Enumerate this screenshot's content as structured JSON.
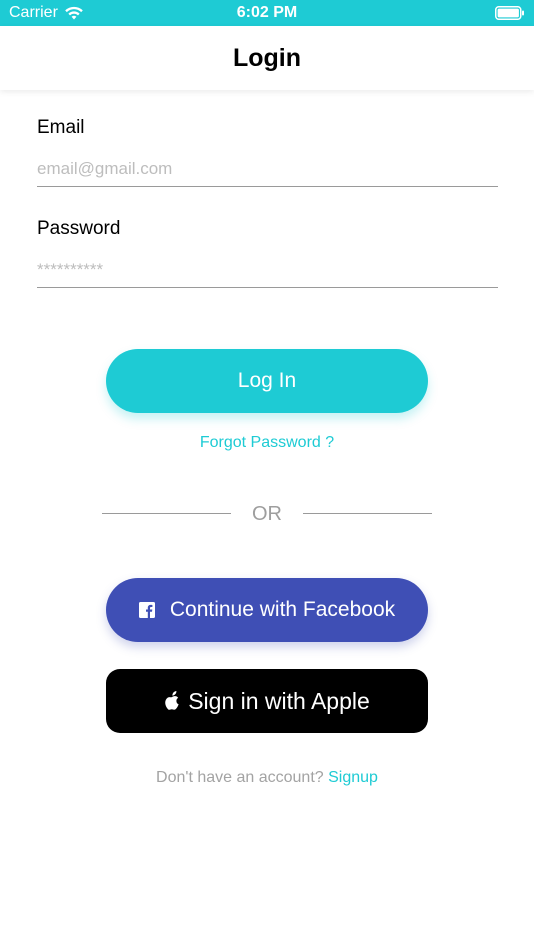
{
  "status_bar": {
    "carrier": "Carrier",
    "time": "6:02 PM",
    "background_color": "#1ecbd4"
  },
  "nav": {
    "title": "Login"
  },
  "form": {
    "email_label": "Email",
    "email_placeholder": "email@gmail.com",
    "email_value": "",
    "password_label": "Password",
    "password_placeholder": "**********",
    "password_value": ""
  },
  "actions": {
    "login_label": "Log In",
    "forgot_label": "Forgot Password ?",
    "or_label": "OR",
    "facebook_label": "Continue with Facebook",
    "apple_label": "Sign in with Apple"
  },
  "signup": {
    "prompt": "Don't have an account?",
    "link": "Signup"
  },
  "icons": {
    "wifi": "wifi-icon",
    "battery": "battery-icon",
    "facebook": "facebook-icon",
    "apple": "apple-icon"
  },
  "colors": {
    "accent": "#1ecbd4",
    "facebook": "#3f4fb5",
    "apple": "#000000",
    "muted": "#9e9e9e"
  }
}
